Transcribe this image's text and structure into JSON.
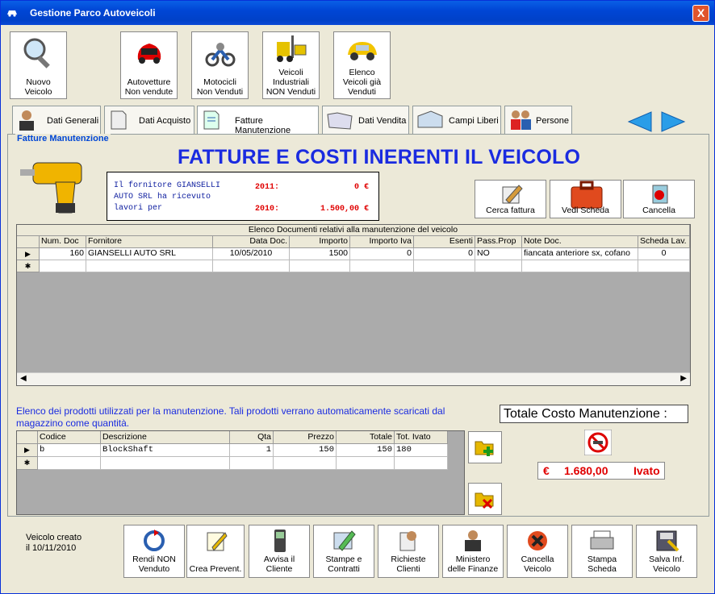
{
  "window": {
    "title": "Gestione Parco Autoveicoli",
    "close_label": "X"
  },
  "toolbar": {
    "nuovo": "Nuovo\nVeicolo",
    "autovetture": "Autovetture\nNon vendute",
    "motocicli": "Motocicli\nNon Venduti",
    "industriali": "Veicoli\nIndustriali\nNON Venduti",
    "elenco": "Elenco\nVeicoli già\nVenduti"
  },
  "tabs": [
    "Dati Generali",
    "Dati Acquisto",
    "Fatture Manutenzione",
    "Dati Vendita",
    "Campi Liberi",
    "Persone"
  ],
  "frame_title": "Fatture Manutenzione",
  "big_title": "FATTURE E COSTI INERENTI IL VEICOLO",
  "info": {
    "line1": "Il fornitore GIANSELLI",
    "line2": "AUTO SRL  ha ricevuto",
    "line3": "lavori per",
    "y1_label": "2011:",
    "y1_value": "0 €",
    "y2_label": "2010:",
    "y2_value": "1.500,00 €"
  },
  "actions": {
    "cerca": "Cerca fattura",
    "vedi": "Vedi Scheda",
    "cancella": "Cancella"
  },
  "docs_grid": {
    "caption": "Elenco Documenti relativi alla manutenzione del veicolo",
    "columns": [
      "Num. Doc",
      "Fornitore",
      "Data Doc.",
      "Importo",
      "Importo Iva",
      "Esenti",
      "Pass.Prop",
      "Note Doc.",
      "Scheda Lav."
    ],
    "rows": [
      [
        "160",
        "GIANSELLI AUTO SRL",
        "10/05/2010",
        "1500",
        "0",
        "0",
        "NO",
        "fiancata anteriore sx, cofano",
        "0"
      ]
    ]
  },
  "products_note": "Elenco dei prodotti utilizzati per la manutenzione. Tali prodotti verrano automaticamente scaricati dal magazzino come quantità.",
  "prod_grid": {
    "columns": [
      "Codice",
      "Descrizione",
      "Qta",
      "Prezzo",
      "Totale",
      "Tot. Ivato"
    ],
    "rows": [
      [
        "b",
        "BlockShaft",
        "1",
        "150",
        "150",
        "180"
      ]
    ]
  },
  "totale": {
    "label": "Totale Costo Manutenzione :",
    "currency": "€",
    "value": "1.680,00",
    "suffix": "Ivato"
  },
  "footer": {
    "created": "Veicolo creato\nil 10/11/2010",
    "buttons": [
      "Rendi NON\nVenduto",
      "Crea Prevent.",
      "Avvisa il\nCliente",
      "Stampe e\nContratti",
      "Richieste\nClienti",
      "Ministero\ndelle Finanze",
      "Cancella\nVeicolo",
      "Stampa\nScheda",
      "Salva Inf.\nVeicolo"
    ]
  },
  "colors": {
    "title_blue": "#1A2BE0",
    "red_text": "#E00000",
    "note_blue": "#1A2BE0"
  }
}
